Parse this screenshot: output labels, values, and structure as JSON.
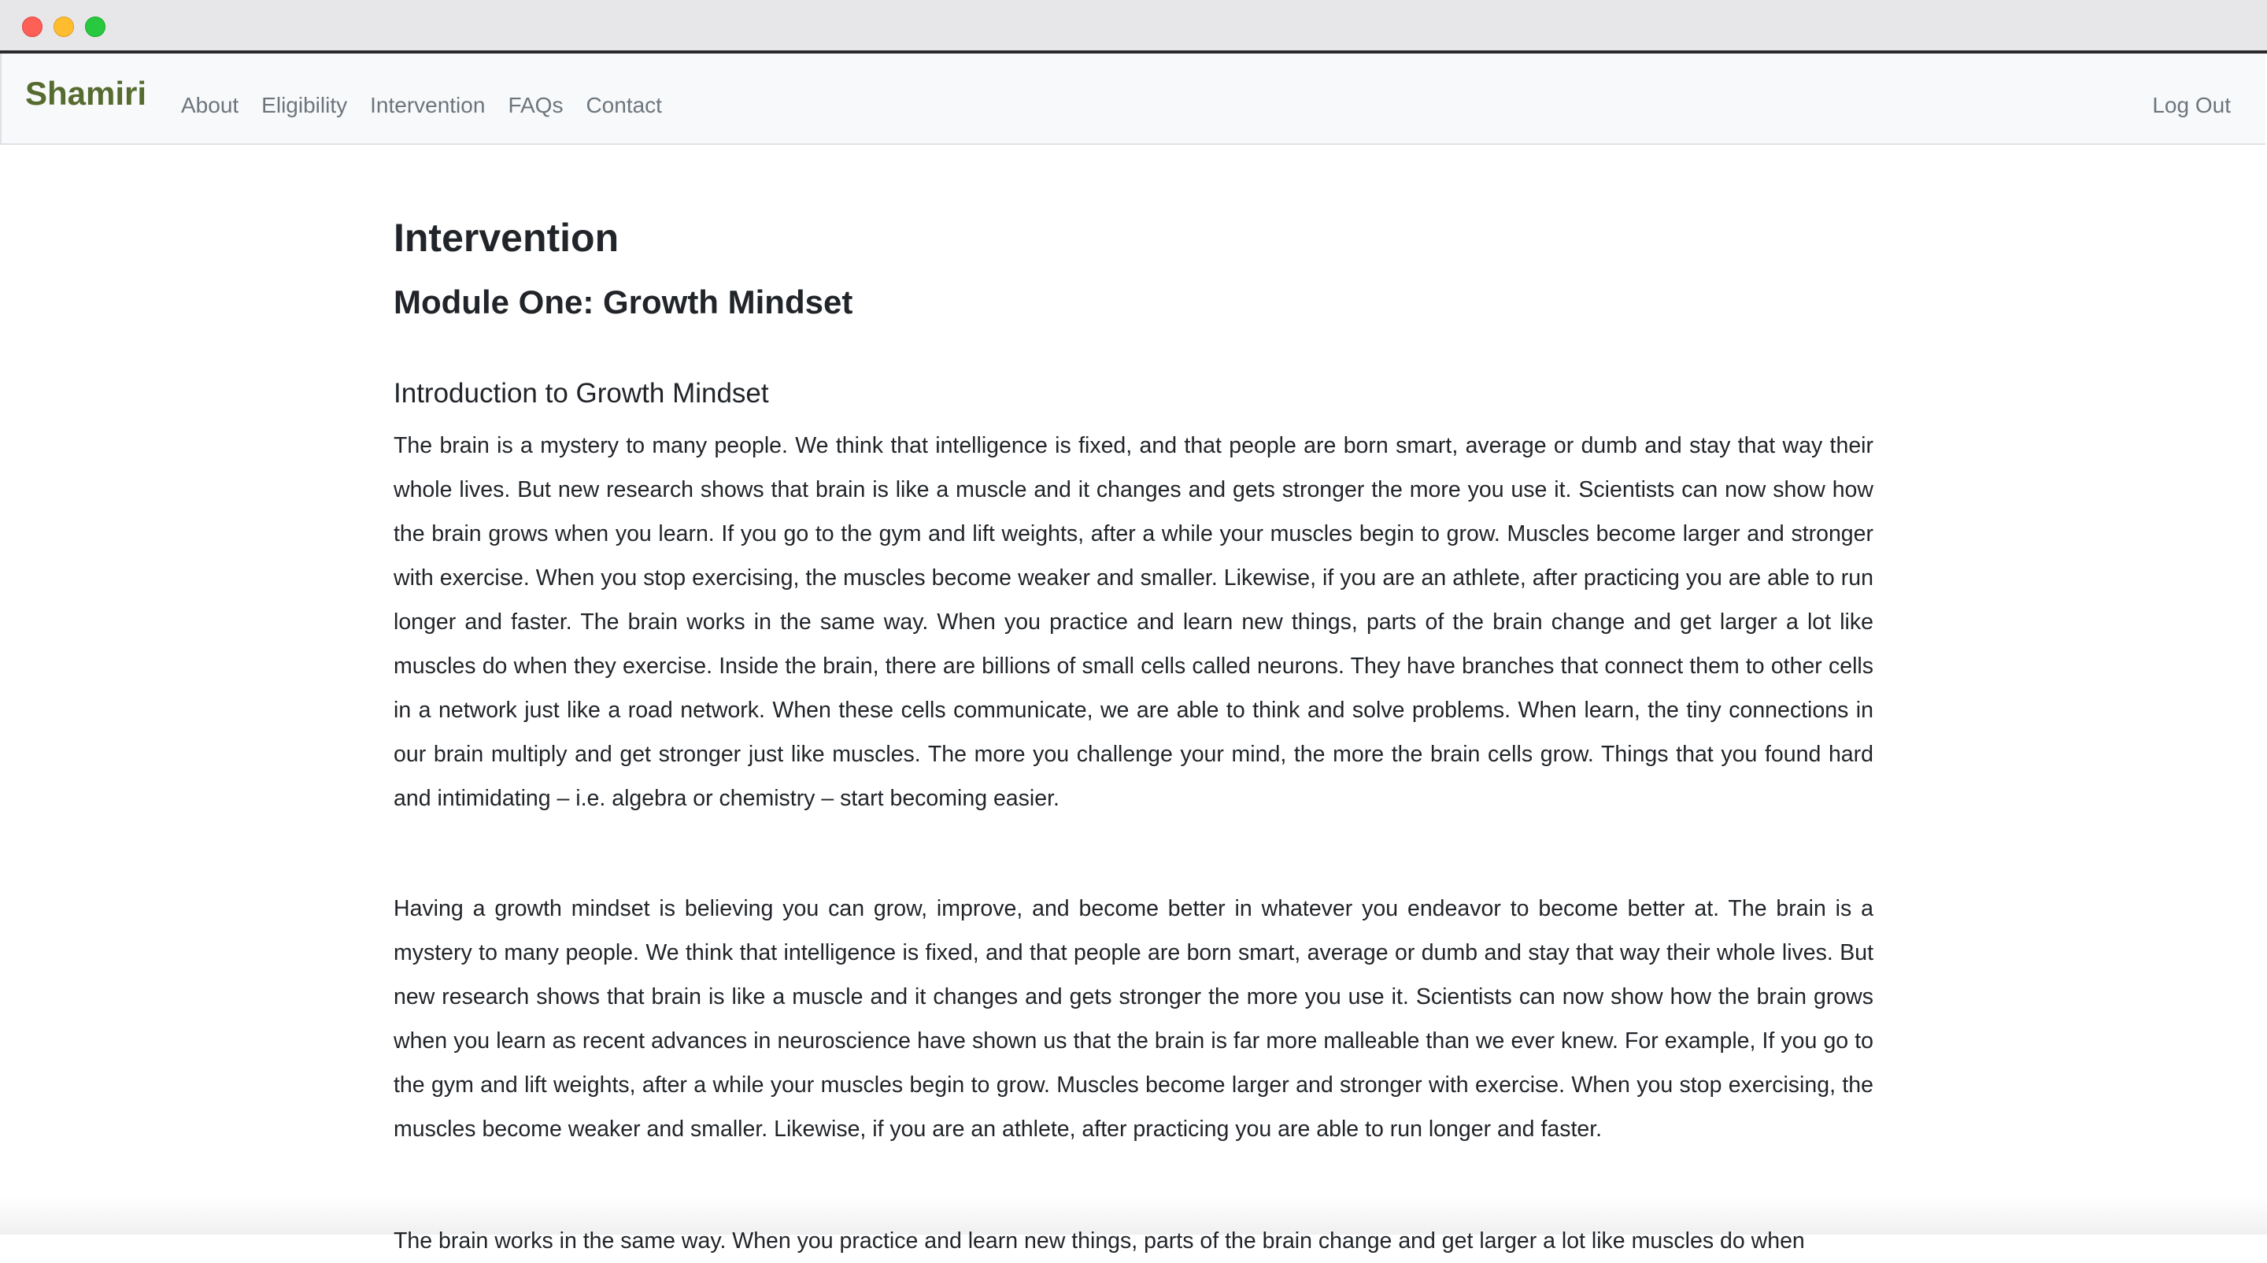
{
  "window": {
    "controls": [
      "close",
      "minimize",
      "maximize"
    ]
  },
  "navbar": {
    "brand": "Shamiri",
    "links": [
      "About",
      "Eligibility",
      "Intervention",
      "FAQs",
      "Contact"
    ],
    "logout": "Log Out"
  },
  "main": {
    "page_title": "Intervention",
    "module_title": "Module One: Growth Mindset",
    "section_title": "Introduction to Growth Mindset",
    "paragraphs": [
      "The brain is a mystery to many people. We think that intelligence is fixed, and that people are born smart, average or dumb and stay that way their whole lives. But new research shows that brain is like a muscle and it changes and gets stronger the more you use it. Scientists can now show how the brain grows when you learn. If you go to the gym and lift weights, after a while your muscles begin to grow. Muscles become larger and stronger with exercise. When you stop exercising, the muscles become weaker and smaller. Likewise, if you are an athlete, after practicing you are able to run longer and faster. The brain works in the same way. When you practice and learn new things, parts of the brain change and get larger a lot like muscles do when they exercise. Inside the brain, there are billions of small cells called neurons. They have branches that connect them to other cells in a network just like a road network. When these cells communicate, we are able to think and solve problems. When learn, the tiny connections in our brain multiply and get stronger just like muscles. The more you challenge your mind, the more the brain cells grow. Things that you found hard and intimidating – i.e. algebra or chemistry – start becoming easier.",
      "Having a growth mindset is believing you can grow, improve, and become better in whatever you endeavor to become better at. The brain is a mystery to many people. We think that intelligence is fixed, and that people are born smart, average or dumb and stay that way their whole lives. But new research shows that brain is like a muscle and it changes and gets stronger the more you use it. Scientists can now show how the brain grows when you learn as recent advances in neuroscience have shown us that the brain is far more malleable than we ever knew. For example, If you go to the gym and lift weights, after a while your muscles begin to grow. Muscles become larger and stronger with exercise. When you stop exercising, the muscles become weaker and smaller. Likewise, if you are an athlete, after practicing you are able to run longer and faster.",
      "The brain works in the same way. When you practice and learn new things, parts of the brain change and get larger a lot like muscles do when"
    ]
  }
}
